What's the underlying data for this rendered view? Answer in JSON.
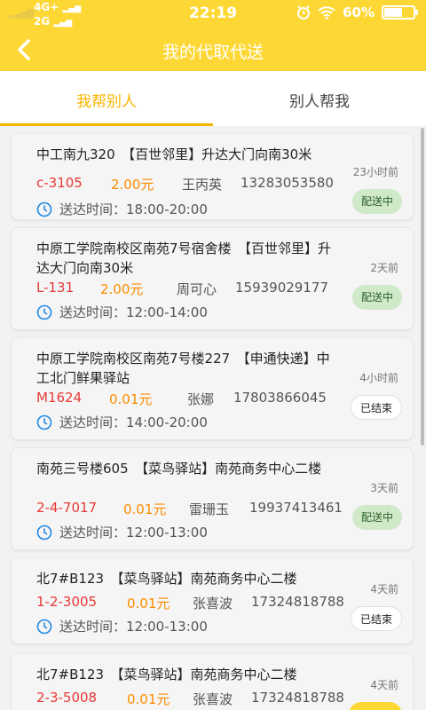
{
  "status_bar": {
    "network_top": "4G+",
    "network_bottom": "2G",
    "time": "22:19",
    "battery": "60%",
    "battery_level": 0.6
  },
  "header": {
    "title": "我的代取代送"
  },
  "tabs": [
    {
      "label": "我帮别人",
      "active": true
    },
    {
      "label": "别人帮我",
      "active": false
    }
  ],
  "orders": [
    {
      "address": "中工南九320　【百世邻里】升达大门向南30米",
      "code": "c-3105",
      "price": "2.00元",
      "name": "王丙英",
      "phone": "13283053580",
      "delivery_time": "送达时间：18:00-20:00",
      "ago": "23小时前",
      "status": "配送中"
    },
    {
      "address": "中原工学院南校区南苑7号宿舍楼　【百世邻里】升达大门向南30米",
      "code": "L-131",
      "price": "2.00元",
      "name": "周可心",
      "phone": "15939029177",
      "delivery_time": "送达时间：12:00-14:00",
      "ago": "2天前",
      "status": "配送中"
    },
    {
      "address": "中原工学院南校区南苑7号楼227　【申通快递】中工北门鲜果驿站",
      "code": "M1624",
      "price": "0.01元",
      "name": "张娜",
      "phone": "17803866045",
      "delivery_time": "送达时间：14:00-20:00",
      "ago": "4小时前",
      "status": "已结束"
    },
    {
      "address": "南苑三号楼605　【菜鸟驿站】南苑商务中心二楼",
      "code": "2-4-7017",
      "price": "0.01元",
      "name": "雷珊玉",
      "phone": "19937413461",
      "delivery_time": "送达时间：12:00-13:00",
      "ago": "3天前",
      "status": "配送中"
    },
    {
      "address": "北7#B123　【菜鸟驿站】南苑商务中心二楼",
      "code": "1-2-3005",
      "price": "0.01元",
      "name": "张喜波",
      "phone": "17324818788",
      "delivery_time": "送达时间：12:00-13:00",
      "ago": "4天前",
      "status": "已结束"
    },
    {
      "address": "北7#B123　【菜鸟驿站】南苑商务中心二楼",
      "code": "2-3-5008",
      "price": "0.01元",
      "name": "张喜波",
      "phone": "17324818788",
      "delivery_time": "",
      "ago": "4天前",
      "status": ""
    }
  ]
}
